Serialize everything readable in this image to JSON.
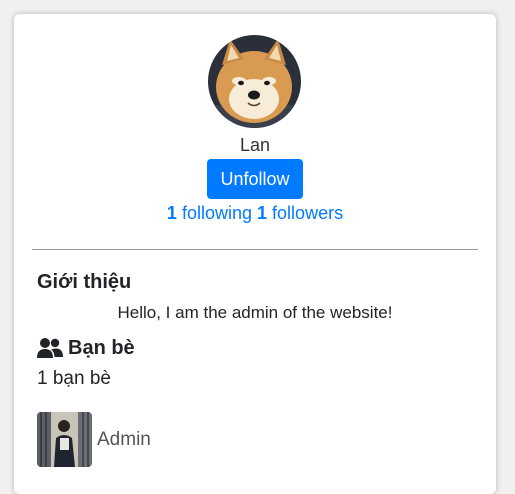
{
  "profile": {
    "name": "Lan",
    "avatar_alt": "shiba-inu-dog-photo",
    "follow_button_label": "Unfollow",
    "following_count": "1",
    "following_label": "following",
    "followers_count": "1",
    "followers_label": "followers"
  },
  "intro": {
    "title": "Giới thiệu",
    "text": "Hello, I am the admin of the website!"
  },
  "friends": {
    "icon": "users-icon",
    "title": "Bạn bè",
    "count_text": "1 bạn bè",
    "items": [
      {
        "name": "Admin"
      }
    ]
  },
  "colors": {
    "accent": "#007bff",
    "button_text": "#ffffff"
  }
}
